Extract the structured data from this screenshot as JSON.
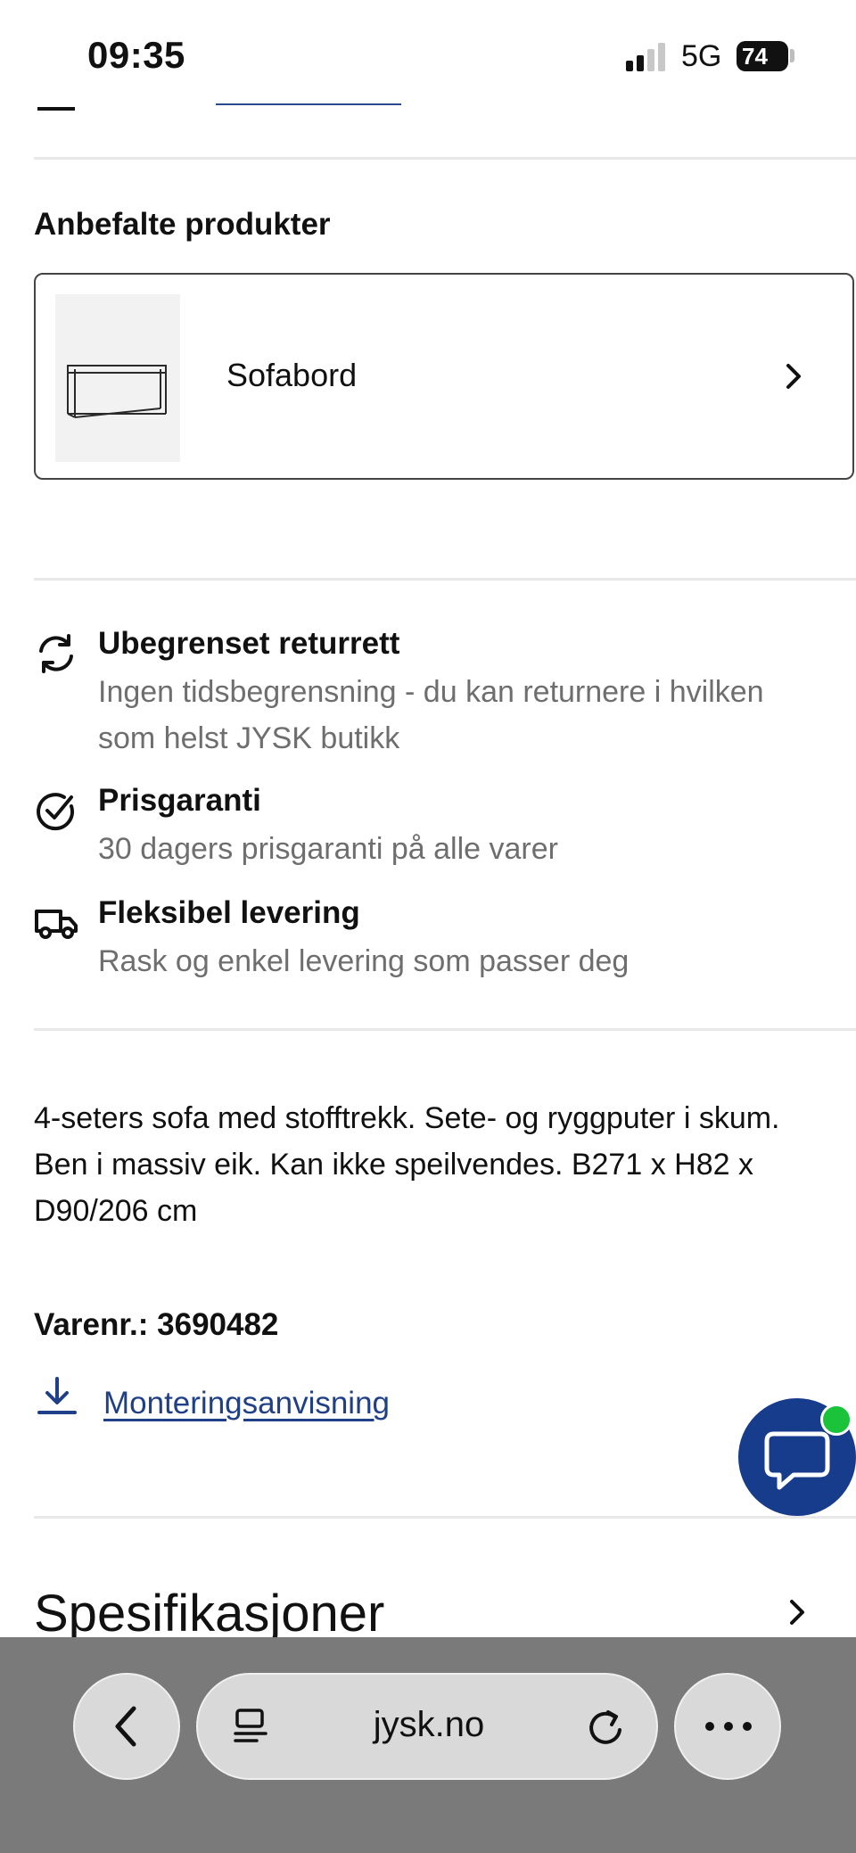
{
  "status_bar": {
    "time": "09:35",
    "network": "5G",
    "battery": "74"
  },
  "recommended": {
    "title": "Anbefalte produkter",
    "product_name": "Sofabord",
    "chevron_icon": "chevron-right-icon"
  },
  "benefits": [
    {
      "icon": "refresh-icon",
      "title": "Ubegrenset returrett",
      "description": "Ingen tidsbegrensning - du kan returnere i hvilken som helst JYSK butikk"
    },
    {
      "icon": "check-circle-icon",
      "title": "Prisgaranti",
      "description": "30 dagers prisgaranti på alle varer"
    },
    {
      "icon": "delivery-truck-icon",
      "title": "Fleksibel levering",
      "description": "Rask og enkel levering som passer deg"
    }
  ],
  "description": "4-seters sofa med stofftrekk. Sete- og ryggputer i skum. Ben i massiv eik. Kan ikke speilvendes. B271 x H82 x D90/206 cm",
  "sku": {
    "label": "Varenr.: ",
    "value": "3690482"
  },
  "manual_link": "Monteringsanvisning",
  "specifications": {
    "title": "Spesifikasjoner"
  },
  "browser": {
    "url": "jysk.no"
  },
  "colors": {
    "accent": "#183c8c",
    "link": "#1f3f86",
    "online": "#1bc33a",
    "muted_text": "#6e6e6e"
  }
}
